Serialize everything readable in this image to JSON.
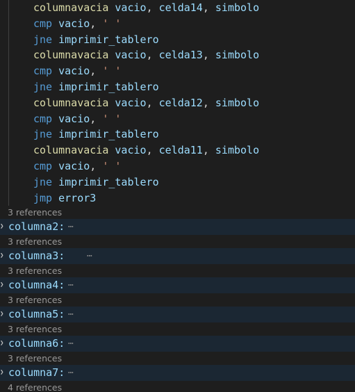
{
  "code_lines": [
    [
      {
        "t": "columnavacia",
        "c": "fn"
      },
      {
        "t": " ",
        "c": "p"
      },
      {
        "t": "vacio",
        "c": "id"
      },
      {
        "t": ", ",
        "c": "p"
      },
      {
        "t": "celda14",
        "c": "id"
      },
      {
        "t": ", ",
        "c": "p"
      },
      {
        "t": "simbolo",
        "c": "id"
      }
    ],
    [
      {
        "t": "cmp",
        "c": "kw"
      },
      {
        "t": " ",
        "c": "p"
      },
      {
        "t": "vacio",
        "c": "id"
      },
      {
        "t": ", ",
        "c": "p"
      },
      {
        "t": "' '",
        "c": "str"
      }
    ],
    [
      {
        "t": "jne",
        "c": "kw"
      },
      {
        "t": " ",
        "c": "p"
      },
      {
        "t": "imprimir_tablero",
        "c": "id"
      }
    ],
    [
      {
        "t": "columnavacia",
        "c": "fn"
      },
      {
        "t": " ",
        "c": "p"
      },
      {
        "t": "vacio",
        "c": "id"
      },
      {
        "t": ", ",
        "c": "p"
      },
      {
        "t": "celda13",
        "c": "id"
      },
      {
        "t": ", ",
        "c": "p"
      },
      {
        "t": "simbolo",
        "c": "id"
      }
    ],
    [
      {
        "t": "cmp",
        "c": "kw"
      },
      {
        "t": " ",
        "c": "p"
      },
      {
        "t": "vacio",
        "c": "id"
      },
      {
        "t": ", ",
        "c": "p"
      },
      {
        "t": "' '",
        "c": "str"
      }
    ],
    [
      {
        "t": "jne",
        "c": "kw"
      },
      {
        "t": " ",
        "c": "p"
      },
      {
        "t": "imprimir_tablero",
        "c": "id"
      }
    ],
    [
      {
        "t": "columnavacia",
        "c": "fn"
      },
      {
        "t": " ",
        "c": "p"
      },
      {
        "t": "vacio",
        "c": "id"
      },
      {
        "t": ", ",
        "c": "p"
      },
      {
        "t": "celda12",
        "c": "id"
      },
      {
        "t": ", ",
        "c": "p"
      },
      {
        "t": "simbolo",
        "c": "id"
      }
    ],
    [
      {
        "t": "cmp",
        "c": "kw"
      },
      {
        "t": " ",
        "c": "p"
      },
      {
        "t": "vacio",
        "c": "id"
      },
      {
        "t": ", ",
        "c": "p"
      },
      {
        "t": "' '",
        "c": "str"
      }
    ],
    [
      {
        "t": "jne",
        "c": "kw"
      },
      {
        "t": " ",
        "c": "p"
      },
      {
        "t": "imprimir_tablero",
        "c": "id"
      }
    ],
    [
      {
        "t": "columnavacia",
        "c": "fn"
      },
      {
        "t": " ",
        "c": "p"
      },
      {
        "t": "vacio",
        "c": "id"
      },
      {
        "t": ", ",
        "c": "p"
      },
      {
        "t": "celda11",
        "c": "id"
      },
      {
        "t": ", ",
        "c": "p"
      },
      {
        "t": "simbolo",
        "c": "id"
      }
    ],
    [
      {
        "t": "cmp",
        "c": "kw"
      },
      {
        "t": " ",
        "c": "p"
      },
      {
        "t": "vacio",
        "c": "id"
      },
      {
        "t": ", ",
        "c": "p"
      },
      {
        "t": "' '",
        "c": "str"
      }
    ],
    [
      {
        "t": "jne",
        "c": "kw"
      },
      {
        "t": " ",
        "c": "p"
      },
      {
        "t": "imprimir_tablero",
        "c": "id"
      }
    ],
    [
      {
        "t": "jmp",
        "c": "kw"
      },
      {
        "t": " ",
        "c": "p"
      },
      {
        "t": "error3",
        "c": "id"
      }
    ]
  ],
  "folded_blocks": [
    {
      "references": "3 references",
      "label": "columna2:",
      "ellipsis": "⋯"
    },
    {
      "references": "3 references",
      "label": "columna3:",
      "ellipsis": "⋯",
      "extra_gap": true
    },
    {
      "references": "3 references",
      "label": "columna4:",
      "ellipsis": "⋯"
    },
    {
      "references": "3 references",
      "label": "columna5:",
      "ellipsis": "⋯"
    },
    {
      "references": "3 references",
      "label": "columna6:",
      "ellipsis": "⋯"
    },
    {
      "references": "3 references",
      "label": "columna7:",
      "ellipsis": "⋯"
    }
  ],
  "trailing_codelens": "4 references",
  "icons": {
    "fold_chevron": "chevron-right-icon"
  },
  "colors": {
    "background": "#1e1e1e",
    "folded_background": "#1b2733",
    "function": "#dcdcaa",
    "keyword": "#569cd6",
    "string": "#ce9178",
    "identifier": "#9cdcfe",
    "codelens": "#999999"
  }
}
